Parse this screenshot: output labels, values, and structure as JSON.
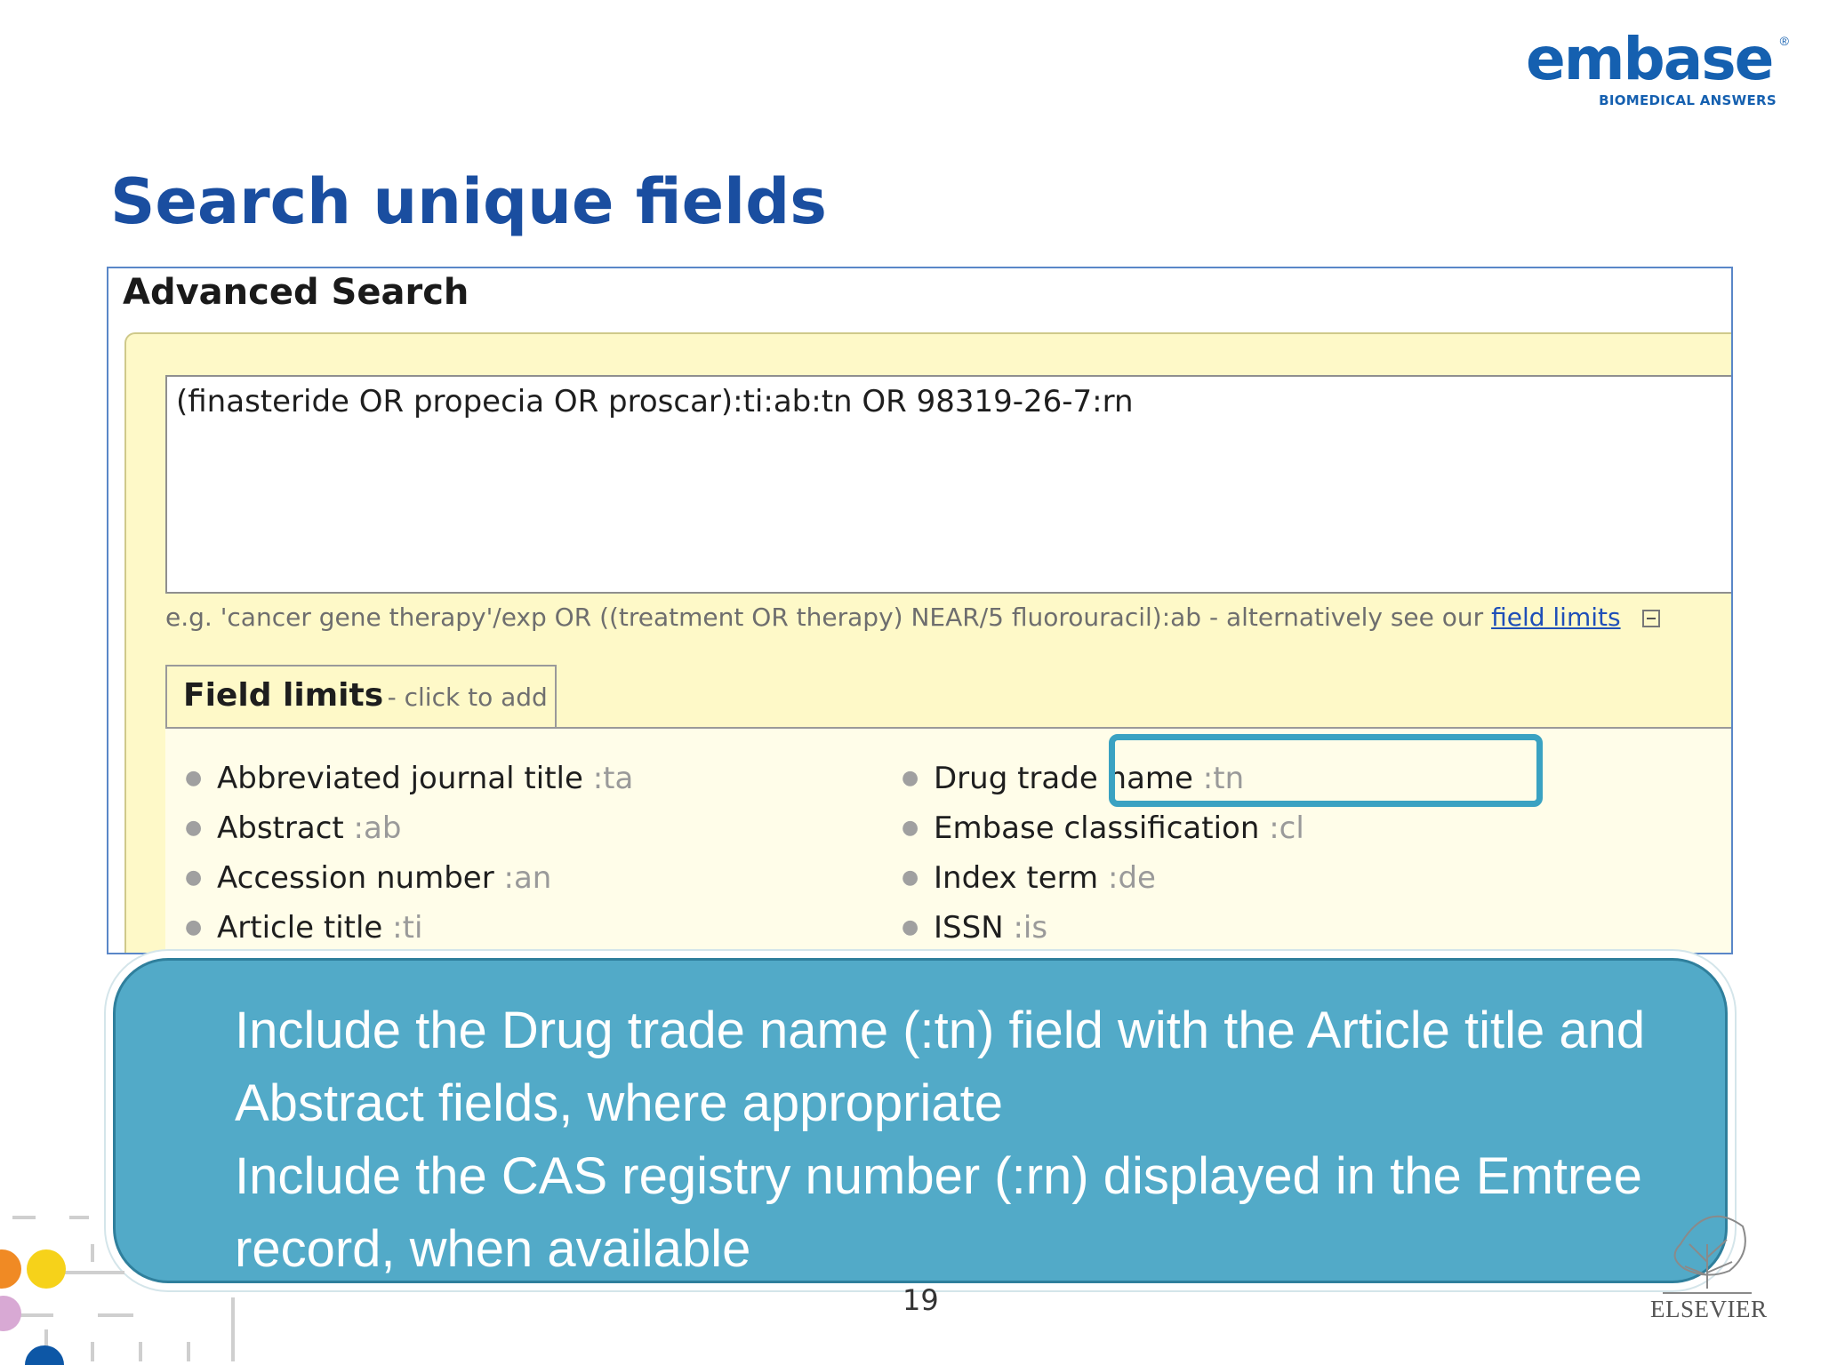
{
  "logo": {
    "word": "embase",
    "registered": "®",
    "tagline": "BIOMEDICAL ANSWERS"
  },
  "slide": {
    "title": "Search unique fields",
    "page_number": "19"
  },
  "advanced_search": {
    "title": "Advanced Search",
    "query": "(finasteride OR propecia OR proscar):ti:ab:tn OR 98319-26-7:rn",
    "example_prefix": "e.g. 'cancer gene therapy'/exp OR ((treatment OR therapy) NEAR/5 fluorouracil):ab - alternatively see our",
    "example_link": "field limits",
    "field_limits": {
      "title": "Field limits",
      "hint": "- click to add",
      "left": [
        {
          "label": "Abbreviated journal title",
          "code": ":ta"
        },
        {
          "label": "Abstract",
          "code": ":ab"
        },
        {
          "label": "Accession number",
          "code": ":an"
        },
        {
          "label": "Article title",
          "code": ":ti"
        }
      ],
      "right": [
        {
          "label": "Drug trade name",
          "code": ":tn"
        },
        {
          "label": "Embase classification",
          "code": ":cl"
        },
        {
          "label": "Index term",
          "code": ":de"
        },
        {
          "label": "ISSN",
          "code": ":is"
        }
      ]
    }
  },
  "callout": {
    "line1": "Include the Drug trade name (:tn) field with the Article title and Abstract fields, where appropriate",
    "line2": "Include the CAS registry number (:rn) displayed in the Emtree record, when available"
  },
  "footer": {
    "publisher": "ELSEVIER"
  },
  "colors": {
    "brand": "#1560b0",
    "title": "#1a4ea0",
    "callout": "#52aac8",
    "highlight": "#3aa2c2",
    "panel": "#fef9c8"
  }
}
